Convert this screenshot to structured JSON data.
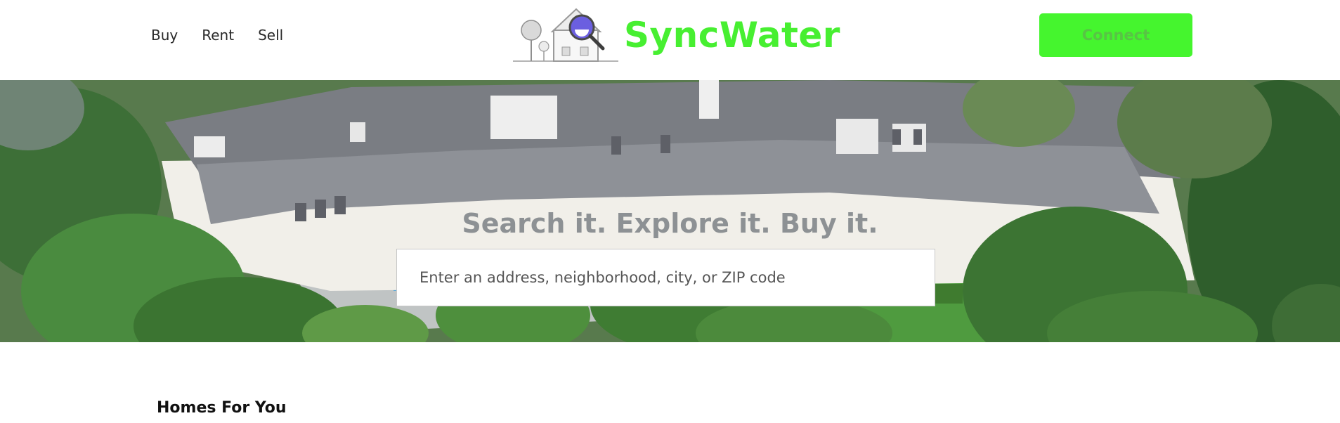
{
  "nav": {
    "items": [
      {
        "label": "Buy"
      },
      {
        "label": "Rent"
      },
      {
        "label": "Sell"
      }
    ]
  },
  "brand": {
    "name": "SyncWater",
    "color": "#47ef31",
    "logo_icon": "house-magnifier-icon"
  },
  "header": {
    "connect_label": "Connect",
    "connect_color": "#45f52e"
  },
  "hero": {
    "title": "Search it. Explore it. Buy it.",
    "search_placeholder": "Enter an address, neighborhood, city, or ZIP code"
  },
  "main": {
    "section_title": "Homes For You"
  }
}
